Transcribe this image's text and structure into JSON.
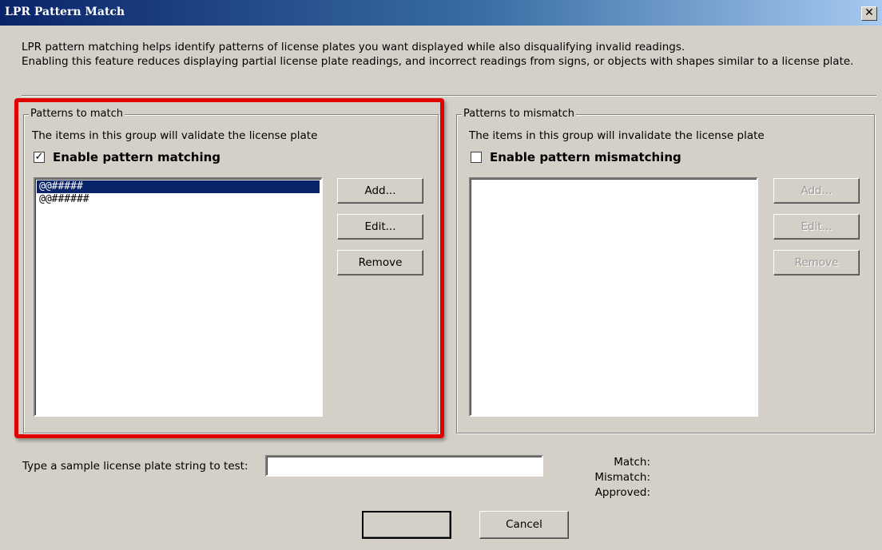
{
  "window": {
    "title": "LPR Pattern Match"
  },
  "description": "LPR pattern matching helps identify patterns of license plates you want displayed while also disqualifying invalid readings.\nEnabling this feature reduces displaying partial license plate readings, and incorrect readings from signs, or objects with shapes similar to a license plate.",
  "match_group": {
    "title": "Patterns to match",
    "info": "The items in this group will validate the license plate",
    "checkbox_label": "Enable pattern matching",
    "checked": true,
    "items": [
      "@@#####",
      "@@######"
    ],
    "selected_index": 0,
    "buttons": {
      "add": "Add...",
      "edit": "Edit...",
      "remove": "Remove"
    }
  },
  "mismatch_group": {
    "title": "Patterns to mismatch",
    "info": "The items in this group will invalidate the license plate",
    "checkbox_label": "Enable pattern mismatching",
    "checked": false,
    "items": [],
    "buttons": {
      "add": "Add...",
      "edit": "Edit...",
      "remove": "Remove"
    }
  },
  "test": {
    "label": "Type a sample license plate string to test:",
    "value": "",
    "match_label": "Match:",
    "mismatch_label": "Mismatch:",
    "approved_label": "Approved:"
  },
  "footer": {
    "ok_label": "",
    "cancel_label": "Cancel"
  },
  "colors": {
    "highlight": "#e00000",
    "selection": "#0a246a"
  }
}
